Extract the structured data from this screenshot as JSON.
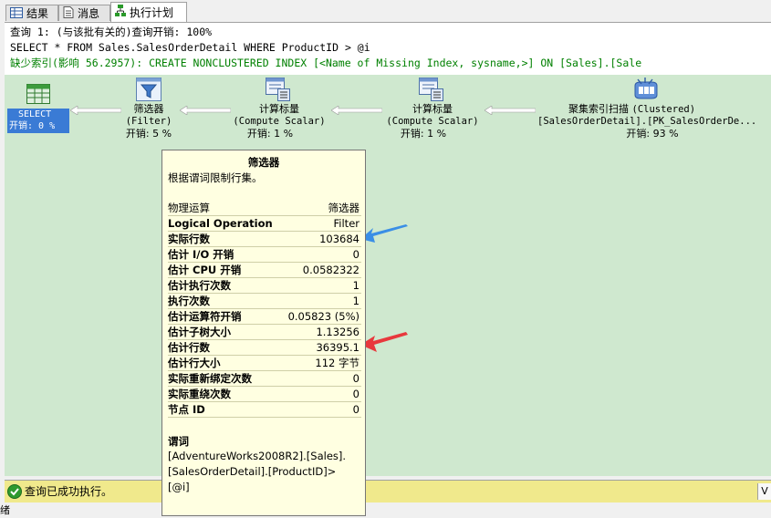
{
  "tabs": [
    {
      "label": "结果",
      "icon": "grid-icon"
    },
    {
      "label": "消息",
      "icon": "messages-icon"
    },
    {
      "label": "执行计划",
      "icon": "execution-plan-icon"
    }
  ],
  "query": {
    "line1": "查询 1: (与该批有关的)查询开销: 100%",
    "line2": "SELECT * FROM Sales.SalesOrderDetail WHERE ProductID > @i",
    "line3": "缺少索引(影响 56.2957): CREATE NONCLUSTERED INDEX [<Name of Missing Index, sysname,>] ON [Sales].[Sale"
  },
  "plan": {
    "select": {
      "line1": "SELECT",
      "line2": "开销: 0 %"
    },
    "filter": {
      "name": "筛选器",
      "sub": "(Filter)",
      "cost": "开销: 5 %"
    },
    "compute1": {
      "name": "计算标量",
      "sub": "(Compute Scalar)",
      "cost": "开销: 1 %"
    },
    "compute2": {
      "name": "计算标量",
      "sub": "(Compute Scalar)",
      "cost": "开销: 1 %"
    },
    "scan": {
      "name": "聚集索引扫描",
      "name_suffix": "(Clustered)",
      "sub": "[SalesOrderDetail].[PK_SalesOrderDe...",
      "cost": "开销: 93 %"
    }
  },
  "tooltip": {
    "title": "筛选器",
    "description": "根据谓词限制行集。",
    "rows": [
      {
        "label": "物理运算",
        "value": "筛选器"
      },
      {
        "label": "Logical Operation",
        "value": "Filter"
      },
      {
        "label": "实际行数",
        "value": "103684"
      },
      {
        "label": "估计 I/O 开销",
        "value": "0"
      },
      {
        "label": "估计 CPU 开销",
        "value": "0.0582322"
      },
      {
        "label": "估计执行次数",
        "value": "1"
      },
      {
        "label": "执行次数",
        "value": "1"
      },
      {
        "label": "估计运算符开销",
        "value": "0.05823 (5%)"
      },
      {
        "label": "估计子树大小",
        "value": "1.13256"
      },
      {
        "label": "估计行数",
        "value": "36395.1"
      },
      {
        "label": "估计行大小",
        "value": "112 字节"
      },
      {
        "label": "实际重新绑定次数",
        "value": "0"
      },
      {
        "label": "实际重绕次数",
        "value": "0"
      },
      {
        "label": "节点 ID",
        "value": "0"
      }
    ],
    "predicate_heading": "谓词",
    "predicate": "[AdventureWorks2008R2].[Sales].[SalesOrderDetail].[ProductID]>[@i]"
  },
  "status": {
    "text": "查询已成功执行。",
    "right": "V"
  },
  "footer": {
    "text": "绪"
  },
  "colors": {
    "annotation_blue": "#3a8ee6",
    "annotation_red": "#e8383d",
    "plan_bg": "#cfe8cf",
    "status_bg": "#f0e98c"
  }
}
